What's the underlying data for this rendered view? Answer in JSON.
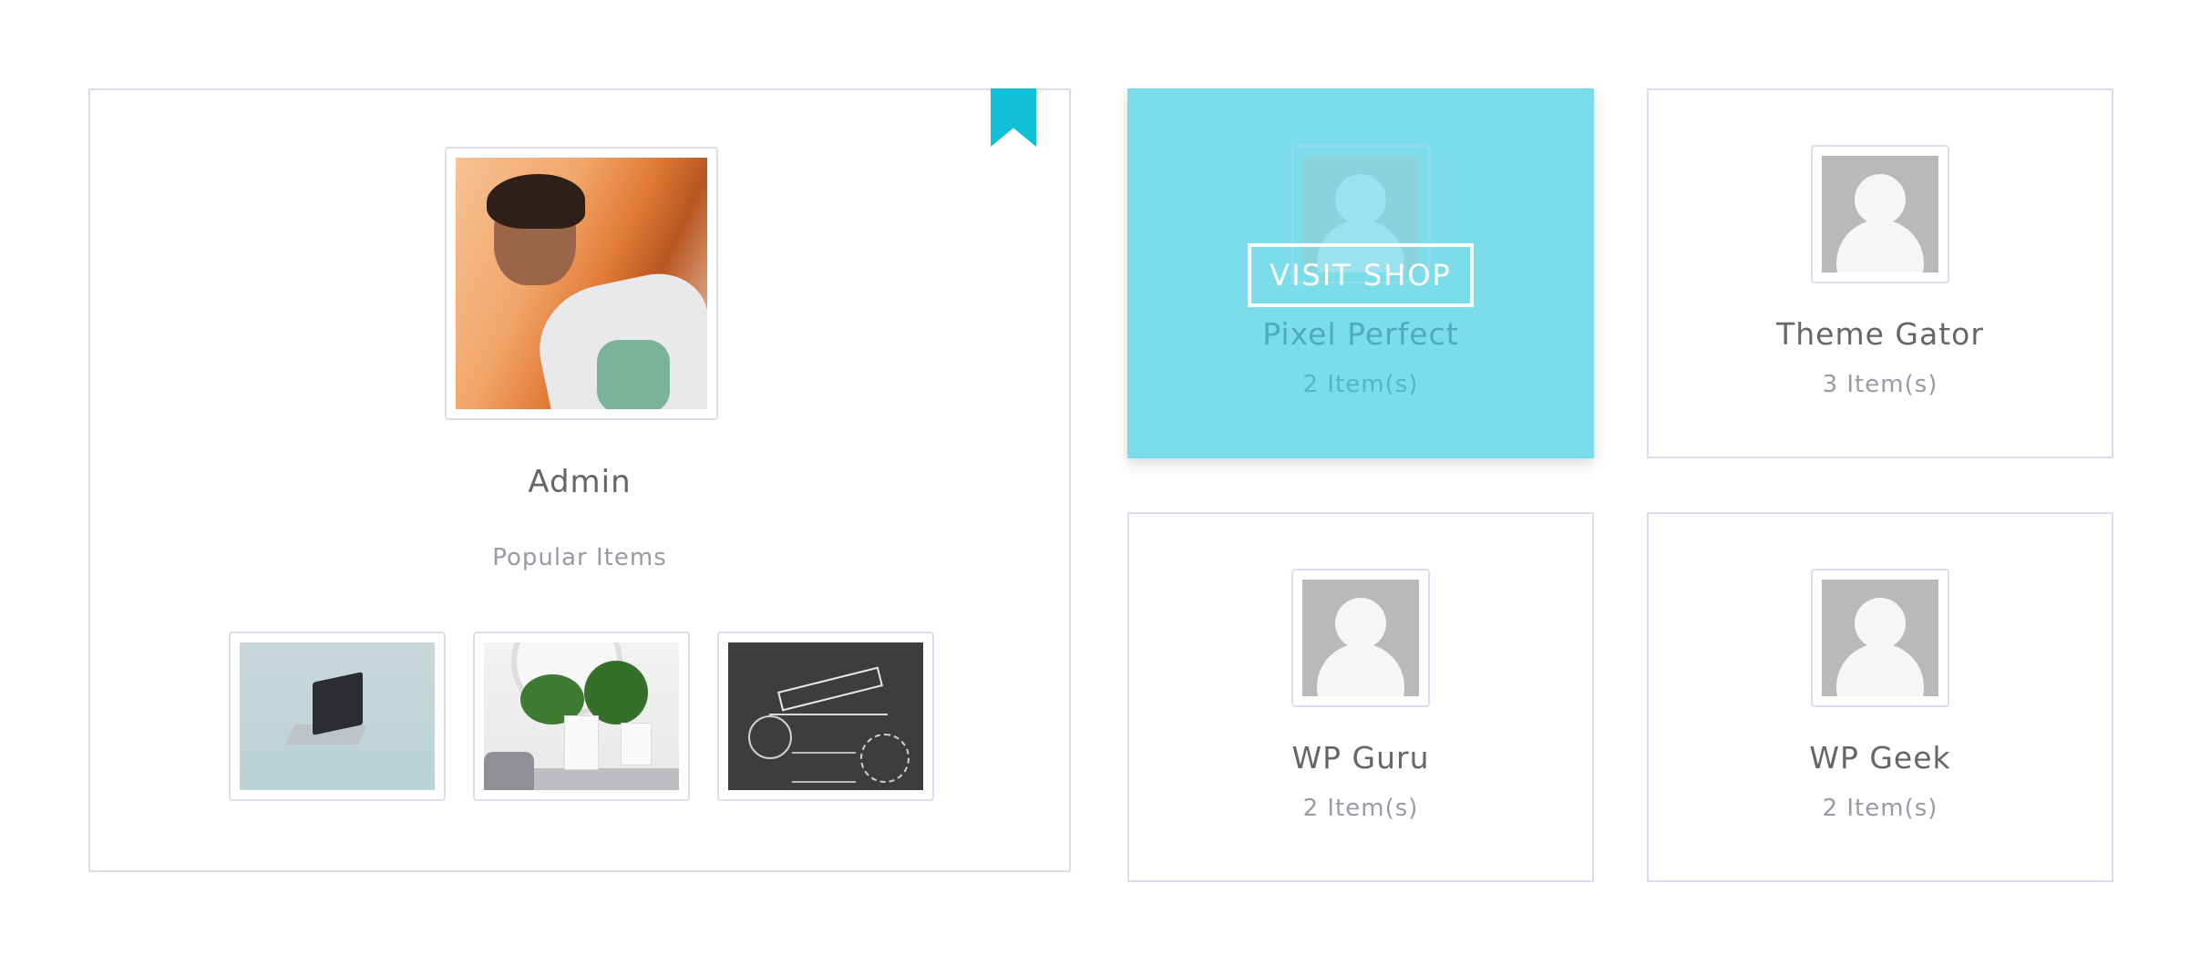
{
  "featured_vendor": {
    "name": "Admin",
    "section_label": "Popular Items",
    "bookmark_color": "#0fc0d6",
    "popular_items": [
      {
        "image": "laptop-image"
      },
      {
        "image": "plants-shelf-image"
      },
      {
        "image": "hand-drawn-rustic-nature-elements-image"
      }
    ]
  },
  "vendors": [
    {
      "name": "Pixel Perfect",
      "count": "2 Item(s)",
      "hovered": true,
      "cta": "VISIT SHOP"
    },
    {
      "name": "Theme Gator",
      "count": "3 Item(s)",
      "hovered": false
    },
    {
      "name": "WP Guru",
      "count": "2 Item(s)",
      "hovered": false
    },
    {
      "name": "WP Geek",
      "count": "2 Item(s)",
      "hovered": false
    }
  ],
  "colors": {
    "accent": "#0fc0d6",
    "hover_overlay": "#7bdcea",
    "border": "#dcdcec",
    "text_primary": "#666666",
    "text_muted": "#9a9aa4"
  }
}
